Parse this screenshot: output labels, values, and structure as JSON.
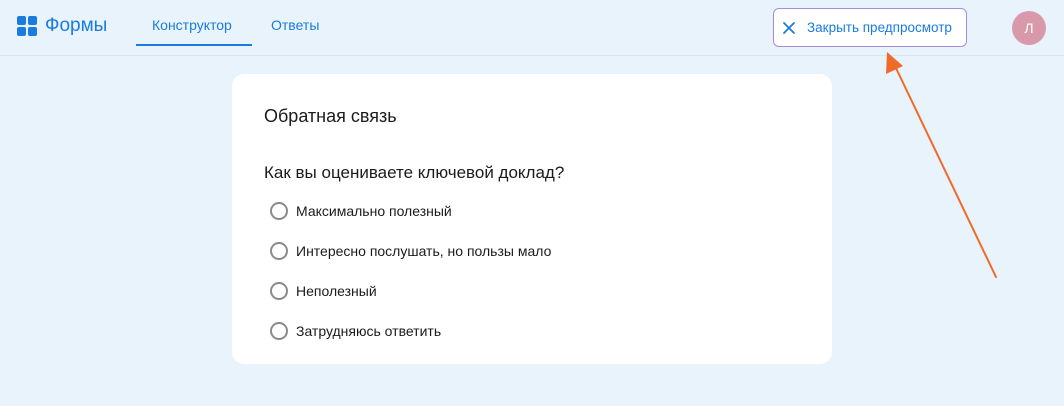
{
  "header": {
    "app_name": "Формы",
    "tabs": [
      {
        "label": "Конструктор",
        "active": true
      },
      {
        "label": "Ответы",
        "active": false
      }
    ],
    "close_preview_label": "Закрыть предпросмотр",
    "avatar_initial": "Л"
  },
  "form": {
    "title": "Обратная связь",
    "question": "Как вы оцениваете ключевой доклад?",
    "options": [
      "Максимально полезный",
      "Интересно послушать, но пользы мало",
      "Неполезный",
      "Затрудняюсь ответить"
    ]
  },
  "colors": {
    "background": "#e8f3fc",
    "accent": "#1a7ce0",
    "close_button_border": "#a78bde",
    "avatar": "#d89aaa",
    "annotation_arrow": "#f06a2a"
  }
}
